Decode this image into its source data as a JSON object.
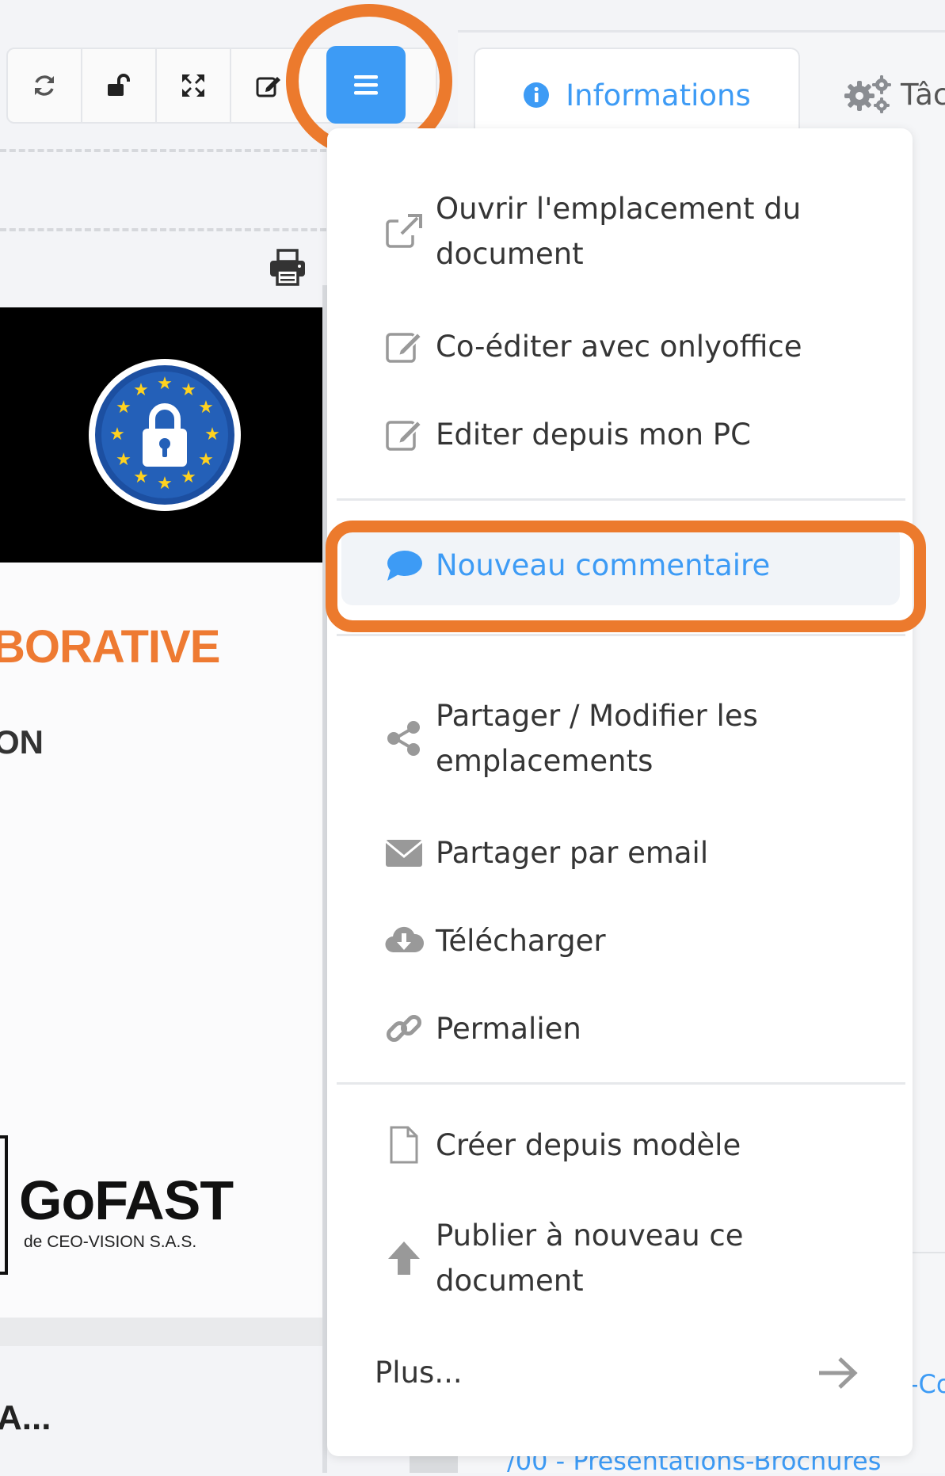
{
  "toolbar": {
    "buttons": [
      {
        "name": "refresh-icon"
      },
      {
        "name": "unlock-icon"
      },
      {
        "name": "fullscreen-icon"
      },
      {
        "name": "edit-icon"
      }
    ],
    "menu_button_icon": "hamburger-icon",
    "accent_color": "#3d9bf5",
    "highlight_color": "#ec7a2d"
  },
  "tabs": {
    "info_label": "Informations",
    "tasks_label": "Tâc"
  },
  "document": {
    "heading": "BORATIVE",
    "subheading": "ON",
    "logo_name": "GoFAST",
    "logo_sub": "de CEO-VISION S.A.S.",
    "ellipsis": "A..."
  },
  "right_panel": {
    "path_text": "/00 - Présentations-Brochures",
    "side_text": "-Co"
  },
  "menu": {
    "open_location": "Ouvrir l'emplacement du document",
    "coedit_onlyoffice": "Co-éditer avec onlyoffice",
    "edit_from_pc": "Editer depuis mon PC",
    "new_comment": "Nouveau commentaire",
    "share_locations": "Partager / Modifier les emplacements",
    "share_email": "Partager par email",
    "download": "Télécharger",
    "permalink": "Permalien",
    "create_from_template": "Créer depuis modèle",
    "republish": "Publier à nouveau ce document",
    "more": "Plus..."
  }
}
